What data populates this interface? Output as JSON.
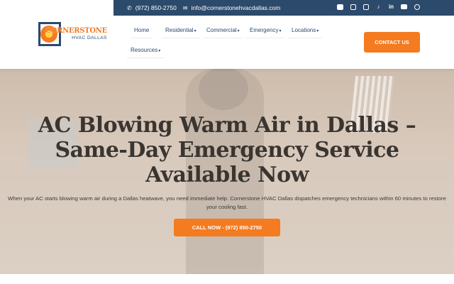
{
  "topbar": {
    "phone": "(972) 850-2750",
    "email": "info@cornerstonehvacdallas.com",
    "phone_icon": "phone-icon",
    "email_icon": "envelope-icon",
    "socials": [
      "facebook-icon",
      "instagram-icon",
      "google-icon",
      "tiktok-icon",
      "linkedin-icon",
      "youtube-icon",
      "pinterest-icon"
    ]
  },
  "logo": {
    "line1": "CORNERSTONE",
    "line2": "HVAC DALLAS"
  },
  "nav": {
    "items": [
      {
        "label": "Home",
        "has_dropdown": false
      },
      {
        "label": "Residential",
        "has_dropdown": true
      },
      {
        "label": "Commercial",
        "has_dropdown": true
      },
      {
        "label": "Emergency",
        "has_dropdown": true
      },
      {
        "label": "Locations",
        "has_dropdown": true
      },
      {
        "label": "Resources",
        "has_dropdown": true
      }
    ],
    "caret": "▾"
  },
  "header": {
    "contact_label": "CONTACT US"
  },
  "hero": {
    "title": "AC Blowing Warm Air in Dallas – Same-Day Emergency Service Available Now",
    "description": "When your AC starts blowing warm air during a Dallas heatwave, you need immediate help. Cornerstone HVAC Dallas dispatches emergency technicians within 60 minutes to restore your cooling fast.",
    "cta_label": "CALL NOW - (972) 850-2750"
  },
  "colors": {
    "brand_navy": "#2c4a6b",
    "brand_orange": "#f47b20"
  }
}
